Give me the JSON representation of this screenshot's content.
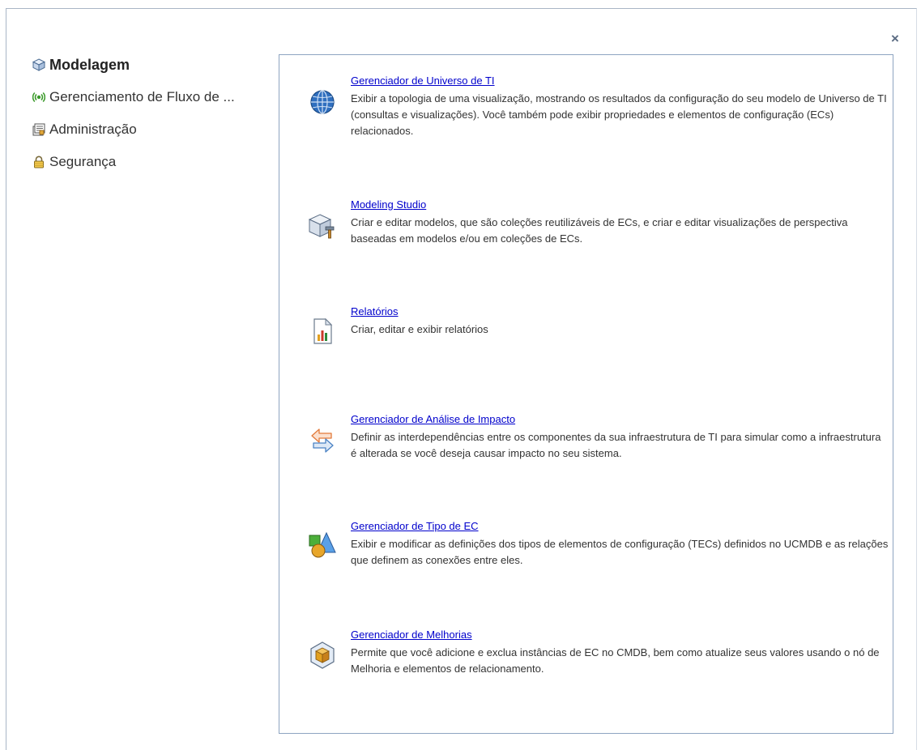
{
  "close_label": "×",
  "nav": {
    "items": [
      {
        "label": "Modelagem",
        "icon": "cube-icon"
      },
      {
        "label": "Gerenciamento de Fluxo de ...",
        "icon": "signal-icon"
      },
      {
        "label": "Administração",
        "icon": "admin-icon"
      },
      {
        "label": "Segurança",
        "icon": "lock-icon"
      }
    ]
  },
  "modules": [
    {
      "title": "Gerenciador de Universo de TI",
      "description": "Exibir a topologia de uma visualização, mostrando os resultados da configuração do seu modelo de Universo de TI (consultas e visualizações). Você também pode exibir propriedades e elementos de configuração (ECs) relacionados.",
      "icon": "globe-icon"
    },
    {
      "title": "Modeling Studio",
      "description": "Criar e editar modelos, que são coleções reutilizáveis de ECs, e criar e editar visualizações de perspectiva baseadas em modelos e/ou em coleções de ECs.",
      "icon": "studio-icon"
    },
    {
      "title": "Relatórios",
      "description": "Criar, editar e exibir relatórios",
      "icon": "report-icon"
    },
    {
      "title": "Gerenciador de Análise de Impacto",
      "description": "Definir as interdependências entre os componentes da sua infraestrutura de TI para simular como a infraestrutura é alterada se você deseja causar impacto no seu sistema.",
      "icon": "impact-arrows-icon"
    },
    {
      "title": "Gerenciador de Tipo de EC",
      "description": "Exibir e modificar as definições dos tipos de elementos de configuração (TECs) definidos no UCMDB e as relações que definem as conexões entre eles.",
      "icon": "shapes-icon"
    },
    {
      "title": "Gerenciador de Melhorias",
      "description": "Permite que você adicione e exclua instâncias de EC no CMDB, bem como atualize seus valores usando o nó de Melhoria e elementos de relacionamento.",
      "icon": "enrichment-icon"
    }
  ]
}
